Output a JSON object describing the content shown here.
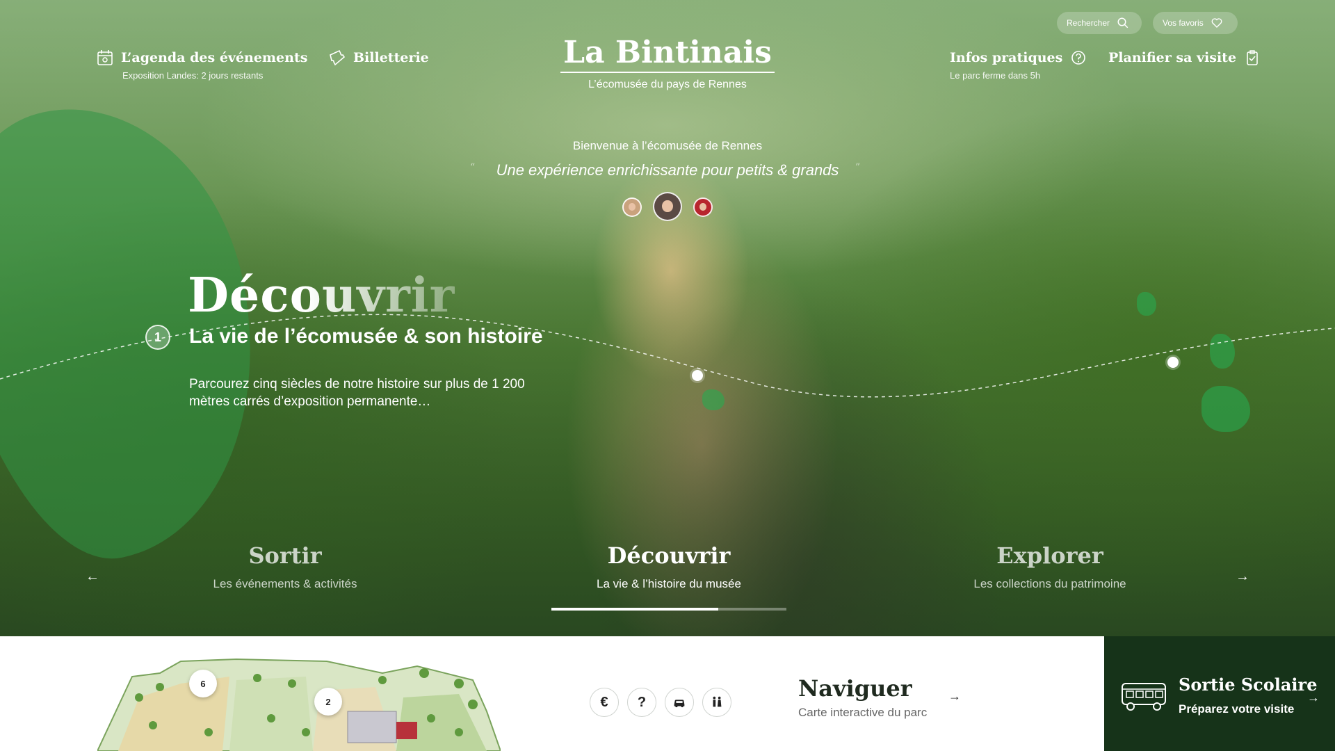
{
  "header": {
    "search_label": "Rechercher",
    "favorites_label": "Vos favoris",
    "nav_left": [
      {
        "label": "L’agenda des événements",
        "sub": "Exposition Landes: 2 jours restants",
        "icon": "calendar-icon"
      },
      {
        "label": "Billetterie",
        "sub": "",
        "icon": "ticket-icon"
      }
    ],
    "brand_title": "La Bintinais",
    "brand_sub": "L’écomusée du pays de Rennes",
    "nav_right": [
      {
        "label": "Infos pratiques",
        "sub": "Le parc ferme dans 5h",
        "icon": "question-icon"
      },
      {
        "label": "Planifier sa visite",
        "sub": "",
        "icon": "clipboard-icon"
      }
    ]
  },
  "hero": {
    "welcome": "Bienvenue à l’écomusée de Rennes",
    "tagline": "Une expérience enrichissante pour petits & grands",
    "heading": "Découvrir",
    "step_number": "1",
    "subheading": "La vie de l’écomusée & son histoire",
    "description": "Parcourez cinq siècles de notre histoire sur plus de 1 200 mètres carrés d’exposition permanente…"
  },
  "slides": [
    {
      "title": "Sortir",
      "sub": "Les événements & activités"
    },
    {
      "title": "Découvrir",
      "sub": "La vie & l’histoire du musée"
    },
    {
      "title": "Explorer",
      "sub": "Les collections du patrimoine"
    }
  ],
  "slide_progress": 0.71,
  "bottom": {
    "map_markers": [
      "6",
      "2"
    ],
    "service_icons": [
      "euro-icon",
      "help-icon",
      "car-icon",
      "toilets-icon"
    ],
    "euro_symbol": "€",
    "help_symbol": "?",
    "naviguer_title": "Naviguer",
    "naviguer_sub": "Carte interactive du parc",
    "school_title": "Sortie Scolaire",
    "school_sub": "Préparez votre visite"
  },
  "colors": {
    "dark_green": "#163319",
    "white": "#ffffff",
    "text_dark": "#1f2a1f"
  }
}
